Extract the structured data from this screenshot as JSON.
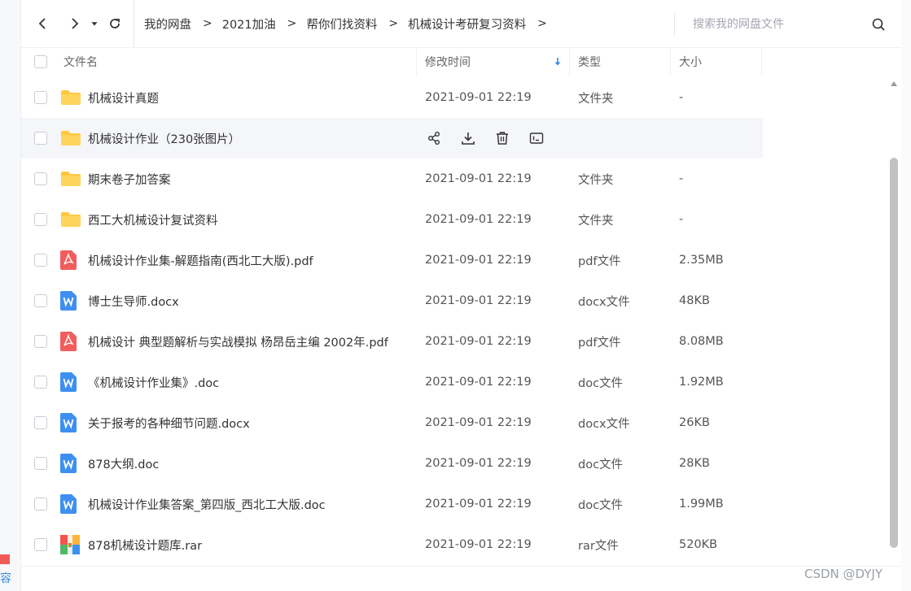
{
  "nav": {
    "back_icon": "chevron-left-icon",
    "forward_icon": "chevron-right-icon",
    "dropdown_icon": "caret-down-icon",
    "refresh_icon": "refresh-icon"
  },
  "breadcrumb": [
    "我的网盘",
    "2021加油",
    "帮你们找资料",
    "机械设计考研复习资料"
  ],
  "breadcrumb_separator": ">",
  "search": {
    "placeholder": "搜索我的网盘文件",
    "icon": "search-icon"
  },
  "columns": {
    "name": "文件名",
    "time": "修改时间",
    "type": "类型",
    "size": "大小"
  },
  "rows": [
    {
      "name": "机械设计真题",
      "time": "2021-09-01 22:19",
      "type": "文件夹",
      "size": "-",
      "icon": "folder-icon"
    },
    {
      "name": "机械设计作业（230张图片）",
      "time": "",
      "type": "",
      "size": "",
      "icon": "folder-icon",
      "hover": true
    },
    {
      "name": "期末卷子加答案",
      "time": "2021-09-01 22:19",
      "type": "文件夹",
      "size": "-",
      "icon": "folder-icon"
    },
    {
      "name": "西工大机械设计复试资料",
      "time": "2021-09-01 22:19",
      "type": "文件夹",
      "size": "-",
      "icon": "folder-icon"
    },
    {
      "name": "机械设计作业集-解题指南(西北工大版).pdf",
      "time": "2021-09-01 22:19",
      "type": "pdf文件",
      "size": "2.35MB",
      "icon": "pdf-icon"
    },
    {
      "name": "博士生导师.docx",
      "time": "2021-09-01 22:19",
      "type": "docx文件",
      "size": "48KB",
      "icon": "word-icon"
    },
    {
      "name": "机械设计 典型题解析与实战模拟 杨昂岳主编 2002年.pdf",
      "time": "2021-09-01 22:19",
      "type": "pdf文件",
      "size": "8.08MB",
      "icon": "pdf-icon"
    },
    {
      "name": "《机械设计作业集》.doc",
      "time": "2021-09-01 22:19",
      "type": "doc文件",
      "size": "1.92MB",
      "icon": "word-icon"
    },
    {
      "name": "关于报考的各种细节问题.docx",
      "time": "2021-09-01 22:19",
      "type": "docx文件",
      "size": "26KB",
      "icon": "word-icon"
    },
    {
      "name": "878大纲.doc",
      "time": "2021-09-01 22:19",
      "type": "doc文件",
      "size": "28KB",
      "icon": "word-icon"
    },
    {
      "name": "机械设计作业集答案_第四版_西北工大版.doc",
      "time": "2021-09-01 22:19",
      "type": "doc文件",
      "size": "1.99MB",
      "icon": "word-icon"
    },
    {
      "name": "878机械设计题库.rar",
      "time": "2021-09-01 22:19",
      "type": "rar文件",
      "size": "520KB",
      "icon": "rar-icon"
    }
  ],
  "hover_actions": [
    "share-icon",
    "download-icon",
    "delete-icon",
    "rename-icon"
  ],
  "watermark": "CSDN @DYJY",
  "colors": {
    "folder": "#ffc83d",
    "pdf": "#f25c5c",
    "word": "#3e8ff0",
    "accent": "#3a8be0"
  },
  "side": {
    "left_text": "容"
  }
}
